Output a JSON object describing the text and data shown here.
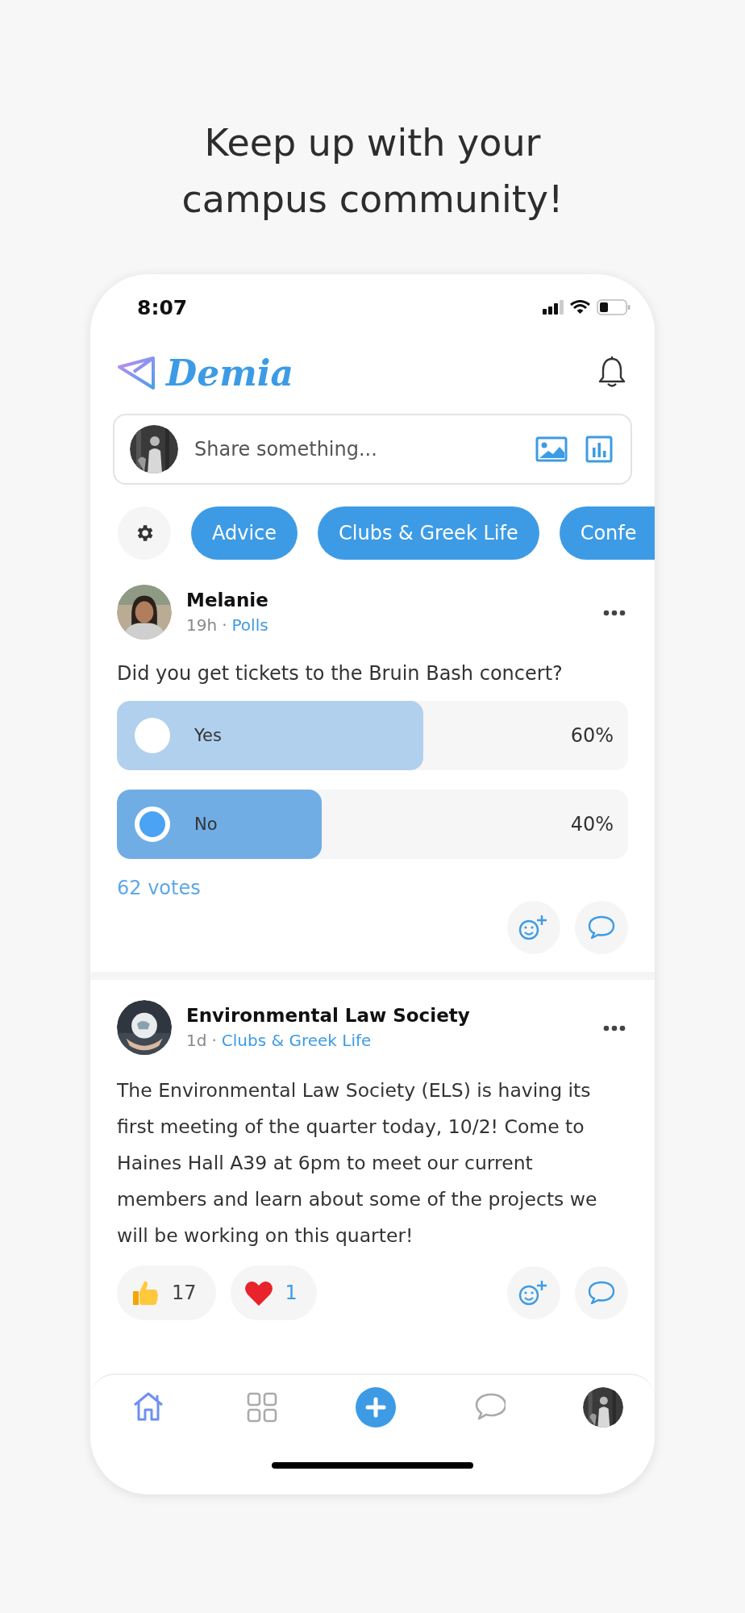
{
  "headline": "Keep up with your campus community!",
  "status_bar": {
    "time": "8:07"
  },
  "app_header": {
    "logo": "Demia"
  },
  "composer": {
    "placeholder": "Share something..."
  },
  "chips": [
    {
      "label": "Advice",
      "clipped": false
    },
    {
      "label": "Clubs & Greek Life",
      "clipped": false
    },
    {
      "label": "Confe",
      "clipped": true
    }
  ],
  "posts": [
    {
      "kind": "poll",
      "author": "Melanie",
      "age": "19h",
      "separator": "·",
      "category": "Polls",
      "text": "Did you get tickets to the Bruin Bash concert?",
      "options": [
        {
          "label": "Yes",
          "percent": "60%",
          "level": 0.6,
          "selected": false
        },
        {
          "label": "No",
          "percent": "40%",
          "level": 0.4,
          "selected": true
        }
      ],
      "votes": "62 votes"
    },
    {
      "kind": "text",
      "author": "Environmental Law Society",
      "age": "1d",
      "separator": "·",
      "category": "Clubs & Greek Life",
      "text": "The Environmental Law Society (ELS) is having its first meeting of the quarter today, 10/2! Come to Haines Hall A39 at 6pm to meet our current members and learn about some of the projects we will be working on this quarter!",
      "reactions": [
        {
          "kind": "thumbs",
          "count": "17",
          "reacted": false
        },
        {
          "kind": "heart",
          "count": "1",
          "reacted": true
        }
      ]
    }
  ],
  "nav": [
    {
      "kind": "home",
      "selected": true
    },
    {
      "kind": "grid",
      "selected": false
    },
    {
      "kind": "add",
      "selected": false
    },
    {
      "kind": "chat",
      "selected": false
    },
    {
      "kind": "avatar",
      "selected": false
    }
  ]
}
